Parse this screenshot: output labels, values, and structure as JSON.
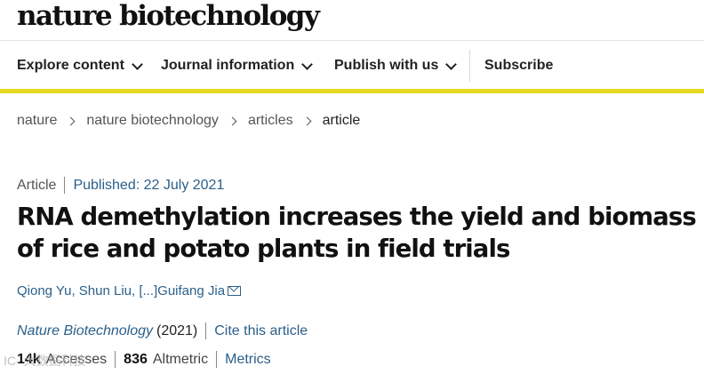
{
  "site": {
    "logo": "nature biotechnology"
  },
  "nav": {
    "explore": "Explore content",
    "journal_info": "Journal information",
    "publish": "Publish with us",
    "subscribe": "Subscribe"
  },
  "breadcrumb": [
    "nature",
    "nature biotechnology",
    "articles",
    "article"
  ],
  "article": {
    "type": "Article",
    "published": "Published: 22 July 2021",
    "title": "RNA demethylation increases the yield and biomass of rice and potato plants in field trials",
    "authors": "Qiong Yu, Shun Liu, [...]Guifang Jia",
    "journal": "Nature Biotechnology",
    "year": "(2021)",
    "cite": "Cite this article",
    "accesses_value": "14k",
    "accesses_label": "Accesses",
    "altmetric_value": "836",
    "altmetric_label": "Altmetric",
    "metrics_link": "Metrics"
  },
  "watermark": "IC- 大数据科技"
}
